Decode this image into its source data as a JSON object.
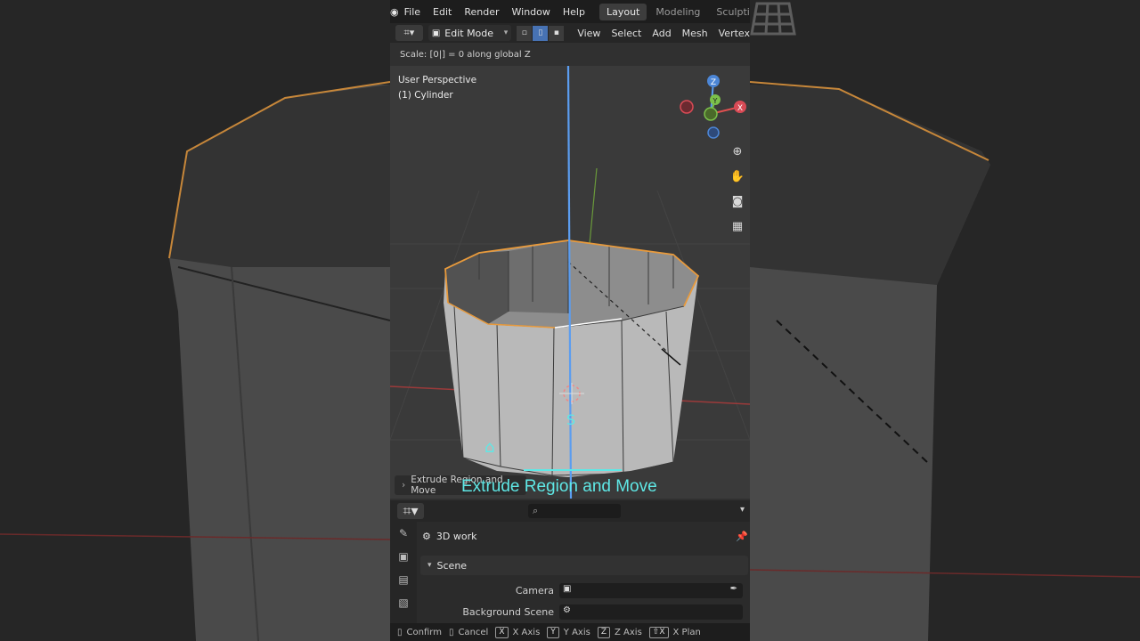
{
  "topbar": {
    "menus": [
      "File",
      "Edit",
      "Render",
      "Window",
      "Help"
    ],
    "workspaces": [
      "Layout",
      "Modeling",
      "Sculptin"
    ],
    "active_workspace": "Layout"
  },
  "toolbar": {
    "mode": "Edit Mode",
    "menus": [
      "View",
      "Select",
      "Add",
      "Mesh",
      "Vertex"
    ]
  },
  "status_line": "Scale: [0|] = 0  along global Z",
  "viewport": {
    "perspective_label": "User Perspective",
    "object_label": "(1) Cylinder",
    "gizmo": {
      "z": "Z",
      "y": "Y",
      "x": "X"
    },
    "scale_key": "S",
    "operator_panel": "Extrude Region and Move",
    "caption": "Extrude Region and Move",
    "colors": {
      "caption": "#5fe8e6",
      "selection": "#e89a3c",
      "z_axis": "#5b9df0"
    }
  },
  "properties": {
    "scene_name": "3D work",
    "panel_title": "Scene",
    "rows": [
      {
        "label": "Camera"
      },
      {
        "label": "Background Scene"
      }
    ]
  },
  "statusbar": {
    "items": [
      {
        "key": "",
        "label": "Confirm"
      },
      {
        "key": "",
        "label": "Cancel"
      },
      {
        "key": "X",
        "label": "X Axis"
      },
      {
        "key": "Y",
        "label": "Y Axis"
      },
      {
        "key": "Z",
        "label": "Z Axis"
      },
      {
        "key": "⇧X",
        "label": "X Plan"
      }
    ]
  }
}
